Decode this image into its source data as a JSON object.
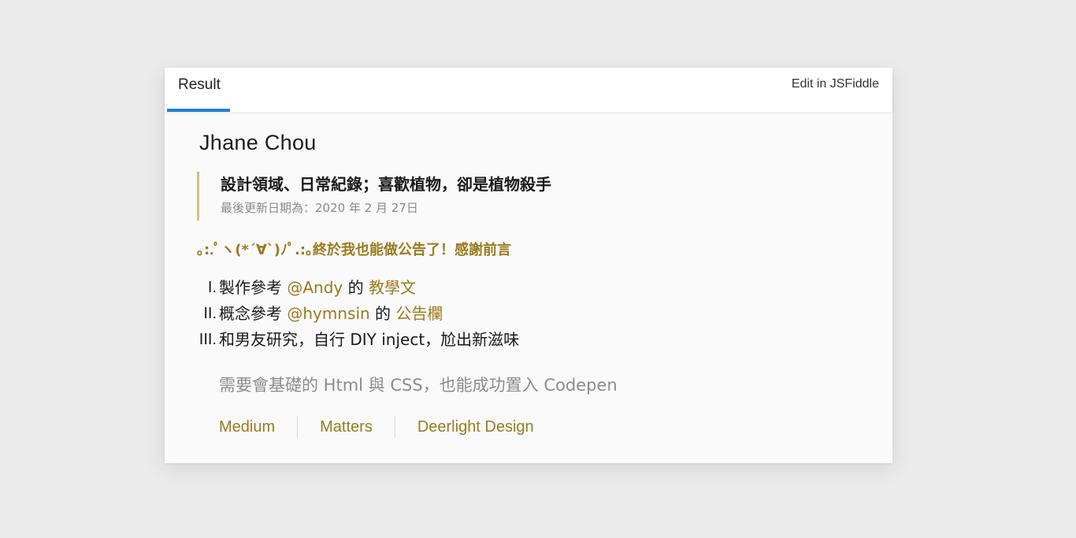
{
  "tabs": {
    "result_label": "Result",
    "edit_label": "Edit in JSFiddle"
  },
  "profile": {
    "name": "Jhane Chou",
    "tagline": "設計領域、日常紀錄；喜歡植物，卻是植物殺手",
    "updated": "最後更新日期為：2020 年 2 月 27日"
  },
  "announcement": "｡:.ﾟヽ(*´∀`)ﾉﾟ.:｡終於我也能做公告了！感謝前言",
  "list": [
    {
      "num": "I.",
      "pre": "製作參考 ",
      "handle": "@Andy",
      "mid": " 的 ",
      "link": "教學文",
      "post": ""
    },
    {
      "num": "II.",
      "pre": "概念參考 ",
      "handle": "@hymnsin",
      "mid": " 的 ",
      "link": "公告欄",
      "post": ""
    },
    {
      "num": "III.",
      "pre": "和男友研究，自行 DIY inject，尬出新滋味",
      "handle": "",
      "mid": "",
      "link": "",
      "post": ""
    }
  ],
  "note": "需要會基礎的 Html 與 CSS，也能成功置入 Codepen",
  "footer_links": [
    "Medium",
    "Matters",
    "Deerlight Design"
  ],
  "colors": {
    "accent_gold": "#9b7b1e",
    "tab_underline": "#1e7fd6",
    "quote_border": "#d6c07a"
  }
}
